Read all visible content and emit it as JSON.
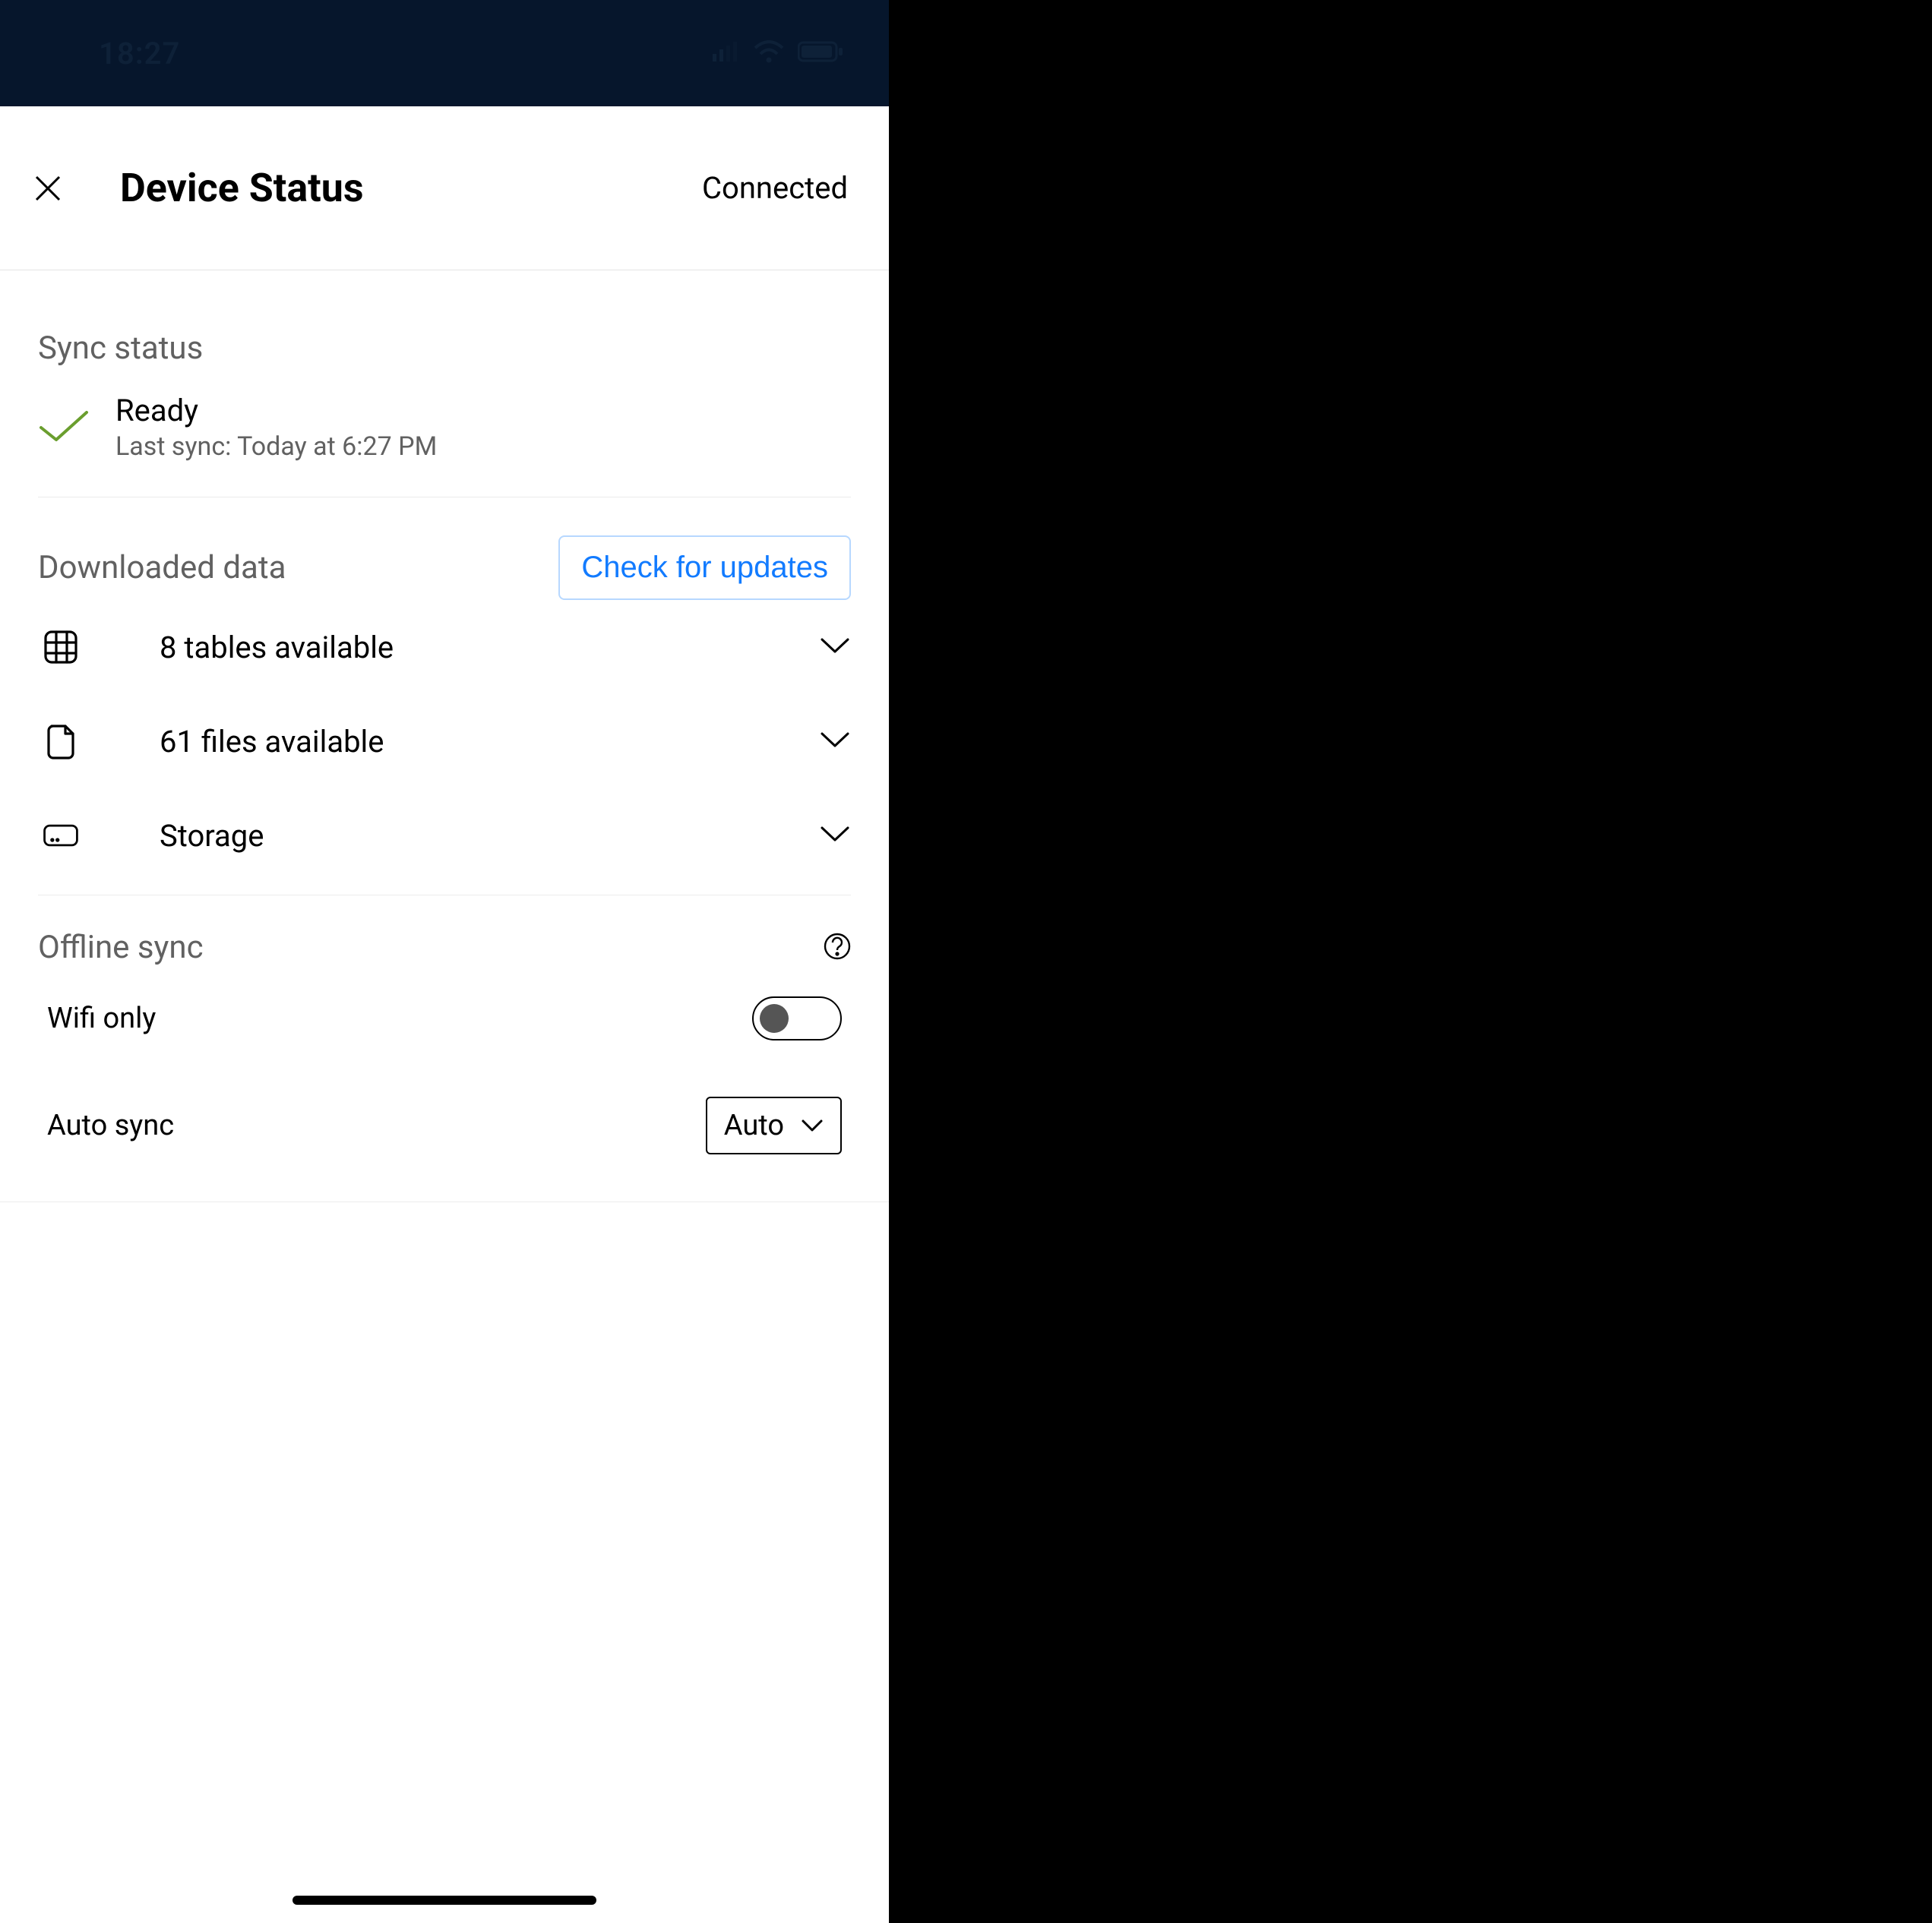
{
  "status_bar": {
    "time": "18:27"
  },
  "nav": {
    "title": "Device Status",
    "connection": "Connected"
  },
  "sync_status": {
    "heading": "Sync status",
    "state": "Ready",
    "last_sync": "Last sync: Today at 6:27 PM"
  },
  "downloaded": {
    "heading": "Downloaded data",
    "check_updates_label": "Check for updates",
    "items": [
      {
        "label": "8 tables available"
      },
      {
        "label": "61 files available"
      },
      {
        "label": "Storage"
      }
    ]
  },
  "offline": {
    "heading": "Offline sync",
    "wifi_only_label": "Wifi only",
    "auto_sync_label": "Auto sync",
    "auto_sync_value": "Auto"
  }
}
